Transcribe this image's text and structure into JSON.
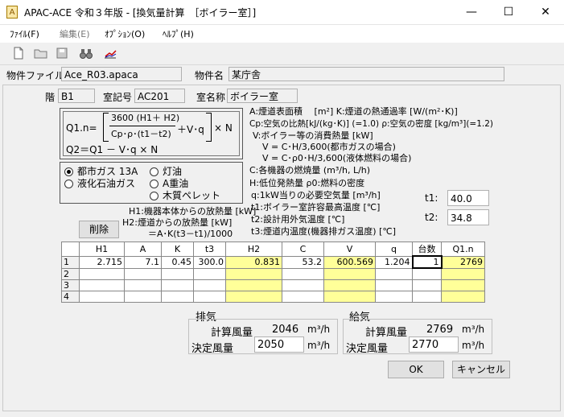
{
  "window": {
    "title": "APAC-ACE 令和３年版 - [換気量計算　［ボイラー室］]",
    "app_icon_glyph": "A",
    "minimize": "—",
    "maximize": "☐",
    "close": "✕"
  },
  "menu": [
    "ﾌｧｲﾙ(F)",
    "編集(E)",
    "ｵﾌﾟｼｮﾝ(O)",
    "ﾍﾙﾌﾟ(H)"
  ],
  "toolbar_icons": [
    "new-file-icon",
    "open-folder-icon",
    "save-icon",
    "binoculars-icon",
    "chart-icon"
  ],
  "header": {
    "file_label": "物件ファイル名",
    "file_value": "Ace_R03.apaca",
    "project_label": "物件名",
    "project_value": "某庁舎",
    "floor_label": "階",
    "floor_value": "B1",
    "room_no_label": "室記号",
    "room_no_value": "AC201",
    "room_name_label": "室名称",
    "room_name_value": "ボイラー室"
  },
  "formula": {
    "lhs": "Q1.n=",
    "numerator": "3600 (H1＋ H2)",
    "denominator": "Cp･ρ･(t1－t2)",
    "plus": "＋V･q",
    "times": "× N",
    "line2": "Q2＝Q1 － V･q × N"
  },
  "fuel": {
    "options": [
      {
        "label": "都市ガス 13A",
        "selected": true
      },
      {
        "label": "灯油",
        "selected": false
      },
      {
        "label": "液化石油ガス",
        "selected": false
      },
      {
        "label": "A重油",
        "selected": false
      },
      {
        "label": "木質ペレット",
        "selected": false
      }
    ]
  },
  "h_notes": {
    "h1": "H1:機器本体からの放熱量 [kW]",
    "h2": "H2:煙道からの放熱量 [kW]",
    "h2_formula": "＝A･K(t3－t1)/1000"
  },
  "delete_button": "削除",
  "legend": [
    "A:煙道表面積　 [m²] K:煙道の熱通過率 [W/(m²･K)]",
    "Cp:空気の比熱[kJ/(kg･K)] (=1.0) ρ:空気の密度 [kg/m³](=1.2)",
    "V:ボイラー等の消費熱量 [kW]",
    "V = C･H/3,600(都市ガスの場合)",
    "V = C･ρ0･H/3,600(液体燃料の場合)",
    "C:各機器の燃焼量 (m³/h, L/h)",
    "H:低位発熱量 ρ0:燃料の密度",
    "q:1kW当りの必要空気量 [m³/h]",
    "t1:ボイラー室許容最高温度 [℃]",
    "t2:設計用外気温度 [℃]",
    "t3:煙道内温度(機器排ガス温度) [℃]"
  ],
  "t1": {
    "label": "t1:",
    "value": "40.0"
  },
  "t2": {
    "label": "t2:",
    "value": "34.8"
  },
  "table": {
    "columns": [
      "",
      "H1",
      "A",
      "K",
      "t3",
      "H2",
      "C",
      "V",
      "q",
      "台数",
      "Q1.n"
    ],
    "rows": [
      [
        "1",
        "2.715",
        "7.1",
        "0.45",
        "300.0",
        "0.831",
        "53.2",
        "600.569",
        "1.204",
        "1",
        "2769"
      ],
      [
        "2",
        "",
        "",
        "",
        "",
        "",
        "",
        "",
        "",
        "",
        ""
      ],
      [
        "3",
        "",
        "",
        "",
        "",
        "",
        "",
        "",
        "",
        "",
        ""
      ],
      [
        "4",
        "",
        "",
        "",
        "",
        "",
        "",
        "",
        "",
        "",
        ""
      ]
    ]
  },
  "exhaust": {
    "title": "排気",
    "calc_label": "計算風量",
    "calc_value": "2046",
    "decided_label": "決定風量",
    "decided_value": "2050",
    "unit": "m³/h"
  },
  "supply": {
    "title": "給気",
    "calc_label": "計算風量",
    "calc_value": "2769",
    "decided_label": "決定風量",
    "decided_value": "2770",
    "unit": "m³/h"
  },
  "ok_button": "OK",
  "cancel_button": "キャンセル"
}
